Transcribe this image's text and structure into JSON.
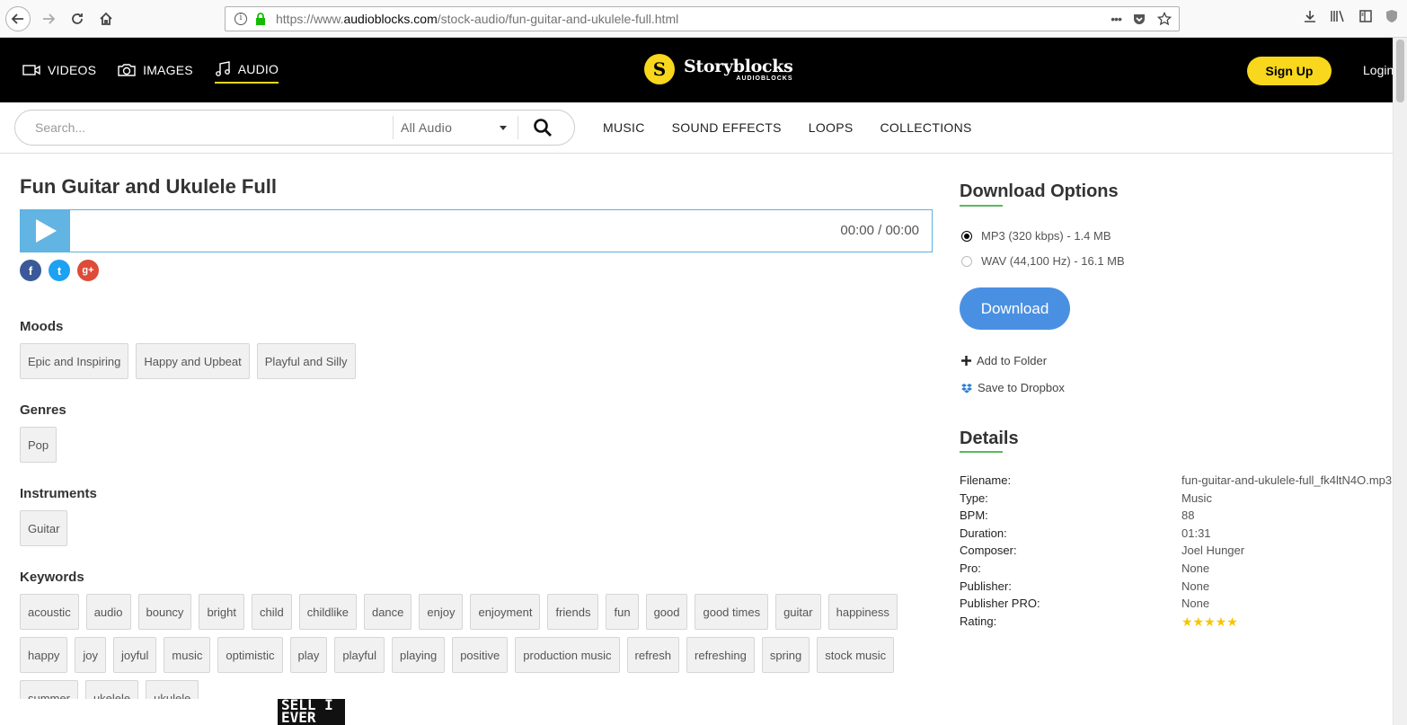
{
  "browser": {
    "url_prefix": "https://www.",
    "url_host": "audioblocks.com",
    "url_path": "/stock-audio/fun-guitar-and-ukulele-full.html",
    "more_actions": "•••"
  },
  "header": {
    "media_nav": [
      {
        "label": "VIDEOS",
        "icon": "video-camera-icon"
      },
      {
        "label": "IMAGES",
        "icon": "camera-icon"
      },
      {
        "label": "AUDIO",
        "icon": "music-note-icon",
        "active": true
      }
    ],
    "brand_mark": "S",
    "brand_name": "Storyblocks",
    "brand_sub": "AUDIOBLOCKS",
    "signup_label": "Sign Up",
    "login_label": "Login",
    "accent_color": "#f8d71c"
  },
  "search": {
    "placeholder": "Search...",
    "category": "All Audio"
  },
  "sub_nav": [
    "MUSIC",
    "SOUND EFFECTS",
    "LOOPS",
    "COLLECTIONS"
  ],
  "track": {
    "title": "Fun Guitar and Ukulele Full",
    "time": "00:00 / 00:00"
  },
  "share": [
    {
      "glyph": "f",
      "icon": "facebook-icon",
      "color": "#3b5998"
    },
    {
      "glyph": "t",
      "icon": "twitter-icon",
      "color": "#1da1f2"
    },
    {
      "glyph": "g+",
      "icon": "google-plus-icon",
      "color": "#dd4b39"
    }
  ],
  "moods": {
    "title": "Moods",
    "tags": [
      "Epic and Inspiring",
      "Happy and Upbeat",
      "Playful and Silly"
    ]
  },
  "genres": {
    "title": "Genres",
    "tags": [
      "Pop"
    ]
  },
  "instruments": {
    "title": "Instruments",
    "tags": [
      "Guitar"
    ]
  },
  "keywords": {
    "title": "Keywords",
    "row1": [
      "acoustic",
      "audio",
      "bouncy",
      "bright",
      "child",
      "childlike",
      "dance",
      "enjoy",
      "enjoyment",
      "friends",
      "fun",
      "good",
      "good times",
      "guitar",
      "happiness"
    ],
    "row2": [
      "happy",
      "joy",
      "joyful",
      "music",
      "optimistic",
      "play",
      "playful",
      "playing",
      "positive",
      "production music",
      "refresh",
      "refreshing",
      "spring",
      "stock music"
    ],
    "row3": [
      "summer",
      "ukelele",
      "ukulele"
    ]
  },
  "ad_text": "SELL I\nEVER",
  "download": {
    "title": "Download Options",
    "options": [
      {
        "label": "MP3 (320 kbps) - 1.4 MB",
        "selected": true
      },
      {
        "label": "WAV (44,100 Hz) - 16.1 MB",
        "selected": false
      }
    ],
    "button_label": "Download",
    "add_to_folder": "Add to Folder",
    "save_to_dropbox": "Save to Dropbox"
  },
  "details": {
    "title": "Details",
    "rows": [
      {
        "label": "Filename:",
        "value": "fun-guitar-and-ukulele-full_fk4ltN4O.mp3"
      },
      {
        "label": "Type:",
        "value": "Music"
      },
      {
        "label": "BPM:",
        "value": "88"
      },
      {
        "label": "Duration:",
        "value": "01:31"
      },
      {
        "label": "Composer:",
        "value": "Joel Hunger"
      },
      {
        "label": "Pro:",
        "value": "None"
      },
      {
        "label": "Publisher:",
        "value": "None"
      },
      {
        "label": "Publisher PRO:",
        "value": "None"
      },
      {
        "label": "Rating:",
        "value": "★★★★★"
      }
    ],
    "rating_stars": 5
  }
}
